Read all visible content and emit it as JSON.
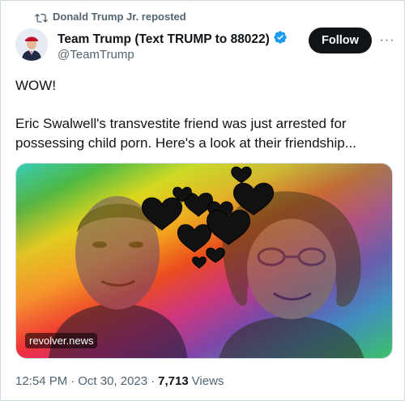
{
  "repost": {
    "text": "Donald Trump Jr. reposted",
    "icon": "repost-icon"
  },
  "author": {
    "display_name": "Team Trump (Text TRUMP to 88022)",
    "handle": "@TeamTrump",
    "verified": true,
    "verified_color": "#1d9bf0"
  },
  "actions": {
    "follow_label": "Follow",
    "more_label": "···"
  },
  "tweet": {
    "line1": "WOW!",
    "body": "Eric Swalwell's transvestite friend was just arrested for possessing child porn. Here's a look at their friendship..."
  },
  "media": {
    "watermark": "revolver.news",
    "description_icon": "rainbow-collage-image"
  },
  "footer": {
    "time": "12:54 PM",
    "date": "Oct 30, 2023",
    "views_count": "7,713",
    "views_label": "Views",
    "separator": "·"
  },
  "colors": {
    "text": "#0f1419",
    "secondary": "#536471",
    "follow_bg": "#0f1419",
    "border": "#cfd9de"
  }
}
